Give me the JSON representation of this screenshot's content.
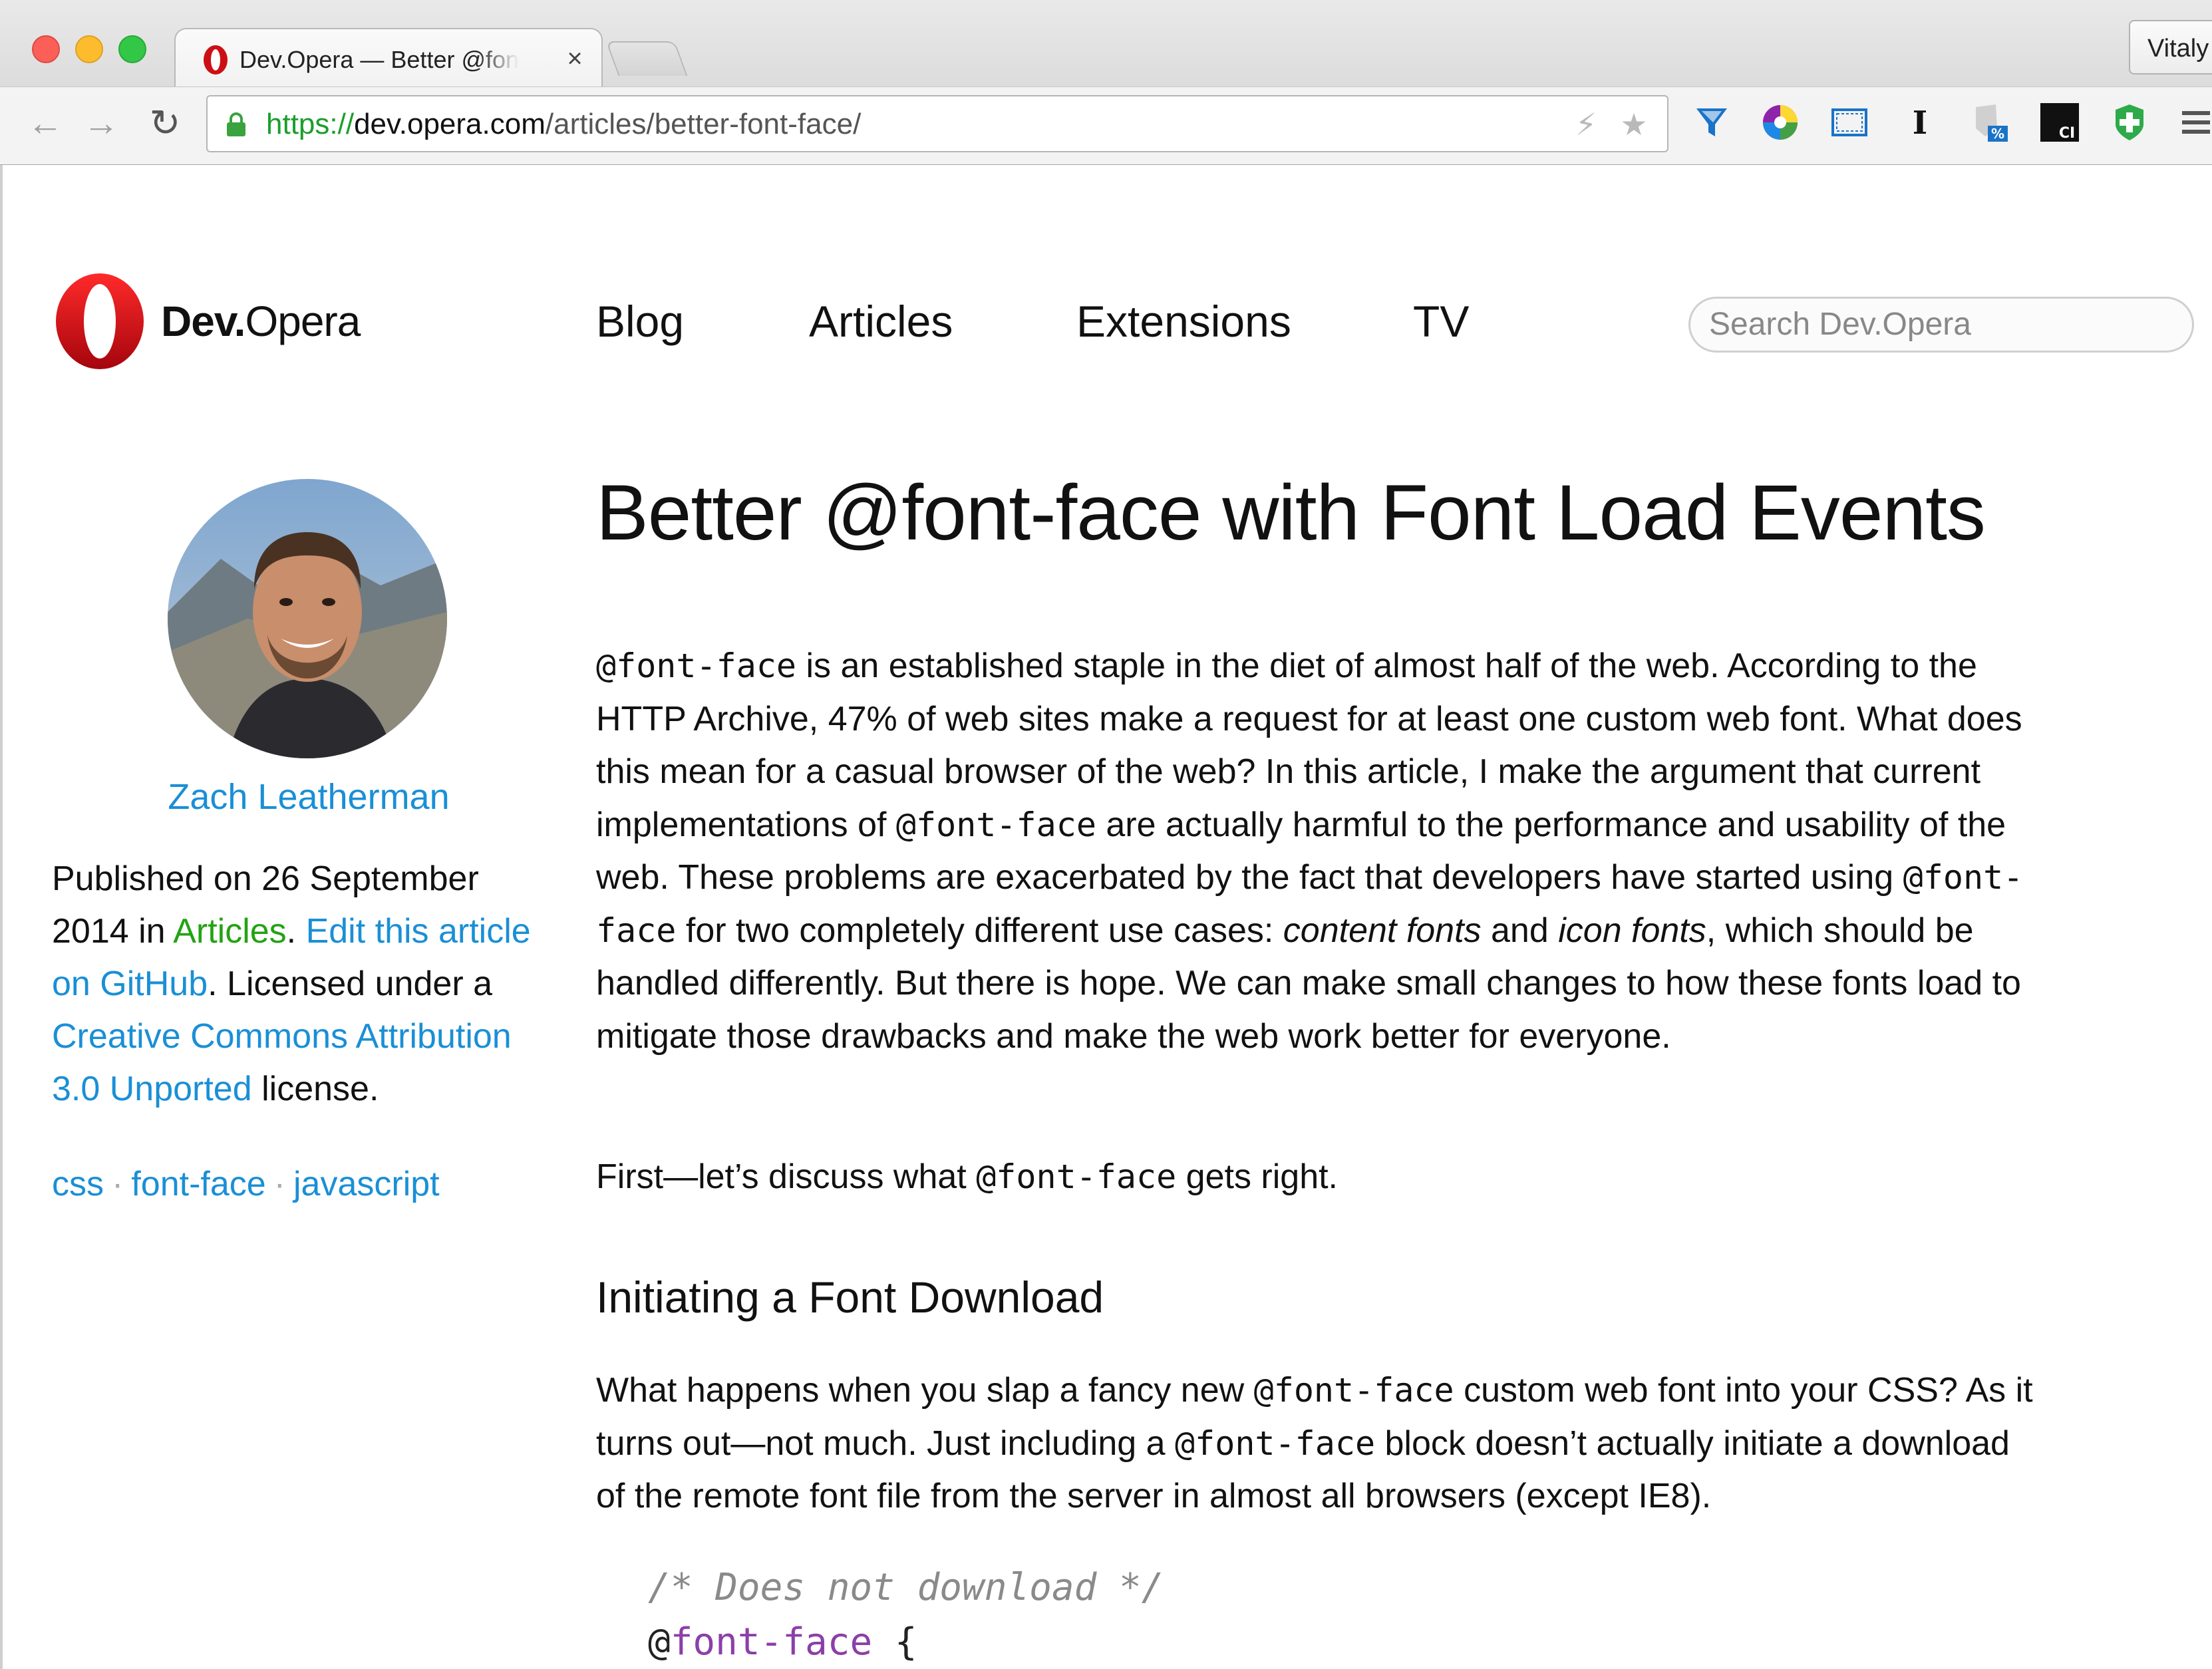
{
  "browser": {
    "tab_title": "Dev.Opera — Better @font-face with Font Load Events",
    "tab_close": "×",
    "profile_name": "Vitaly",
    "url": {
      "scheme": "https://",
      "host": "dev.opera.com",
      "path": "/articles/better-font-face/"
    },
    "extensions": [
      "funnel-icon",
      "color-wheel-icon",
      "window-resize-icon",
      "text-cursor-icon",
      "shield-percent-icon",
      "ci-icon",
      "plus-badge-icon",
      "hamburger-menu-icon"
    ],
    "extension_labels": {
      "shield": "%",
      "ci": "CI"
    }
  },
  "site": {
    "logo_bold": "Dev.",
    "logo_regular": "Opera",
    "nav": [
      "Blog",
      "Articles",
      "Extensions",
      "TV"
    ],
    "search_placeholder": "Search Dev.Opera",
    "brand_color": "#cc0f16",
    "link_color": "#1a8fd6",
    "category_color": "#22a312"
  },
  "sidebar": {
    "author": "Zach Leatherman",
    "published_prefix": "Published on 26 September 2014 in ",
    "category": "Articles",
    "dot": ". ",
    "edit_link": "Edit this article on GitHub",
    "licensed_prefix": ". Licensed under a ",
    "license_link": "Creative Commons Attribution 3.0 Unported",
    "license_suffix": " license.",
    "tags": [
      "css",
      "font-face",
      "javascript"
    ],
    "tag_separator": "·"
  },
  "article": {
    "title": "Better @font-face with Font Load Events",
    "p1": {
      "code1": "@font-face",
      "t1": " is an established staple in the diet of almost half of the web. According to the HTTP Archive, 47% of web sites make a request for at least one custom web font. What does this mean for a casual browser of the web? In this article, I make the argument that current implementations of ",
      "code2": "@font-face",
      "t2": " are actually harmful to the performance and usability of the web. These problems are exacerbated by the fact that developers have started using ",
      "code3": "@font-face",
      "t3": " for two completely different use cases: ",
      "em1": "content fonts",
      "t4": " and ",
      "em2": "icon fonts",
      "t5": ", which should be handled differently. But there is hope. We can make small changes to how these fonts load to mitigate those drawbacks and make the web work better for everyone."
    },
    "p2": {
      "t1": "First—let’s discuss what ",
      "code1": "@font-face",
      "t2": " gets right."
    },
    "h2": "Initiating a Font Download",
    "p3": {
      "t1": "What happens when you slap a fancy new ",
      "code1": "@font-face",
      "t2": " custom web font into your CSS? As it turns out—not much. Just including a ",
      "code2": "@font-face",
      "t3": " block doesn’t actually initiate a download of the remote font file from the server in almost all browsers (except IE8)."
    },
    "code": {
      "comment": "/* Does not download */",
      "at": "@",
      "keyword": "font-face",
      "brace": " {"
    }
  }
}
